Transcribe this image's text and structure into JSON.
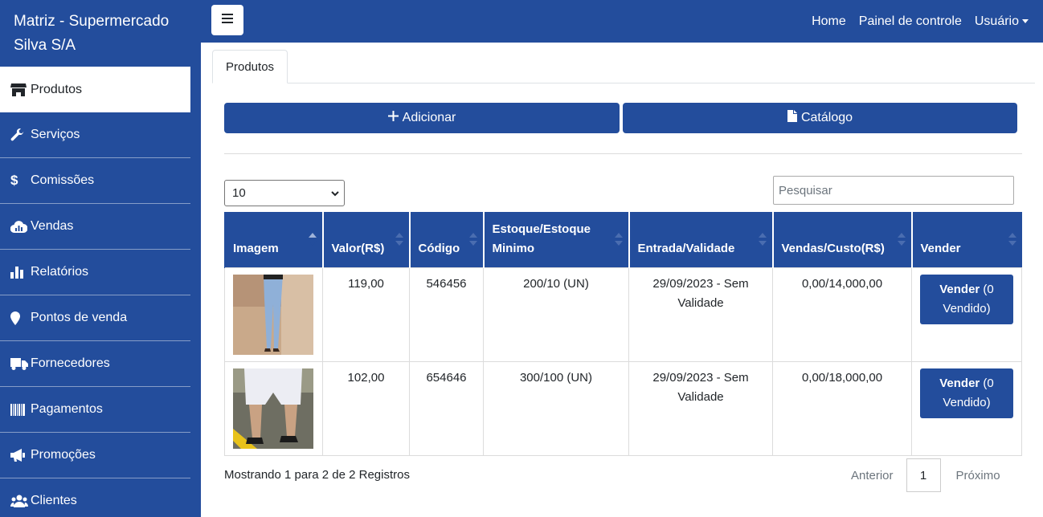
{
  "colors": {
    "primary": "#234d9c",
    "white": "#ffffff"
  },
  "sidebar": {
    "brand": "Matriz - Supermercado Silva S/A",
    "items": [
      {
        "label": "Produtos",
        "icon": "store-icon",
        "active": true
      },
      {
        "label": "Serviços",
        "icon": "wrench-icon",
        "active": false
      },
      {
        "label": "Comissões",
        "icon": "dollar-icon",
        "active": false
      },
      {
        "label": "Vendas",
        "icon": "cloud-chart-icon",
        "active": false
      },
      {
        "label": "Relatórios",
        "icon": "bar-chart-icon",
        "active": false
      },
      {
        "label": "Pontos de venda",
        "icon": "map-marker-icon",
        "active": false
      },
      {
        "label": "Fornecedores",
        "icon": "truck-icon",
        "active": false
      },
      {
        "label": "Pagamentos",
        "icon": "barcode-icon",
        "active": false
      },
      {
        "label": "Promoções",
        "icon": "megaphone-icon",
        "active": false
      },
      {
        "label": "Clientes",
        "icon": "users-icon",
        "active": false
      }
    ]
  },
  "topbar": {
    "home": "Home",
    "dashboard": "Painel de controle",
    "user": "Usuário"
  },
  "tabs": {
    "products": "Produtos"
  },
  "actions": {
    "add": "Adicionar",
    "catalog": "Catálogo"
  },
  "controls": {
    "page_size": "10",
    "search_placeholder": "Pesquisar"
  },
  "table": {
    "headers": {
      "image": "Imagem",
      "value": "Valor(R$)",
      "code": "Código",
      "stock": "Estoque/Estoque Minimo",
      "entry": "Entrada/Validade",
      "sales": "Vendas/Custo(R$)",
      "sell": "Vender"
    },
    "rows": [
      {
        "image": "jeans-photo",
        "value": "119,00",
        "code": "546456",
        "stock": "200/10 (UN)",
        "entry": "29/09/2023 - Sem Validade",
        "sales": "0,00/14,000,00",
        "sell_label": "Vender",
        "sell_count": "(0 Vendido)"
      },
      {
        "image": "shorts-photo",
        "value": "102,00",
        "code": "654646",
        "stock": "300/100 (UN)",
        "entry": "29/09/2023 - Sem Validade",
        "sales": "0,00/18,000,00",
        "sell_label": "Vender",
        "sell_count": "(0 Vendido)"
      }
    ]
  },
  "footer": {
    "info": "Mostrando 1 para 2 de 2 Registros",
    "prev": "Anterior",
    "page": "1",
    "next": "Próximo"
  }
}
